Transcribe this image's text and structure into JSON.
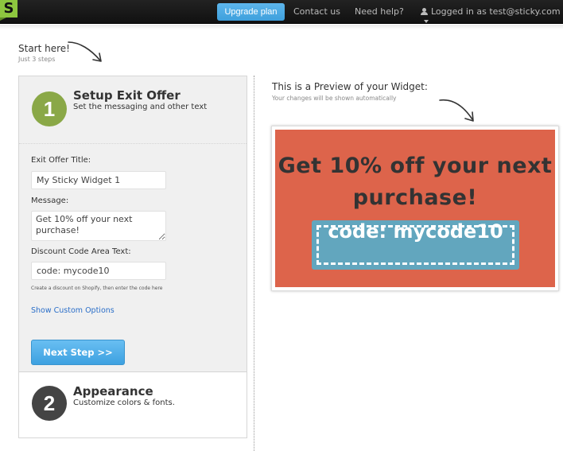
{
  "topbar": {
    "logo_letter": "S",
    "upgrade_label": "Upgrade plan",
    "contact_label": "Contact us",
    "help_label": "Need help?",
    "logged_in_label": "Logged in as test@sticky.com",
    "icons": {
      "user": "user-icon",
      "caret": "caret-down-icon"
    }
  },
  "intro": {
    "title": "Start here!",
    "subtitle": "Just 3 steps"
  },
  "steps": [
    {
      "number": "1",
      "title": "Setup Exit Offer",
      "description": "Set the messaging and other text",
      "circle_color": "#8aa847"
    },
    {
      "number": "2",
      "title": "Appearance",
      "description": "Customize colors & fonts.",
      "circle_color": "#444444"
    }
  ],
  "form": {
    "title_label": "Exit Offer Title:",
    "title_value": "My Sticky Widget 1",
    "message_label": "Message:",
    "message_value": "Get 10% off your next purchase!",
    "code_label": "Discount Code Area Text:",
    "code_value": "code: mycode10",
    "hint": "Create a discount on Shopify, then enter the code here",
    "custom_options_link": "Show Custom Options",
    "next_button": "Next Step >>"
  },
  "preview": {
    "title": "This is a Preview of your Widget:",
    "subtitle": "Your changes will be shown automatically",
    "widget_message": "Get 10% off your next purchase!",
    "widget_code": "code: mycode10",
    "colors": {
      "background": "#dd644b",
      "text": "#333333",
      "code_background": "#62a6be",
      "code_text": "#ffffff"
    }
  }
}
